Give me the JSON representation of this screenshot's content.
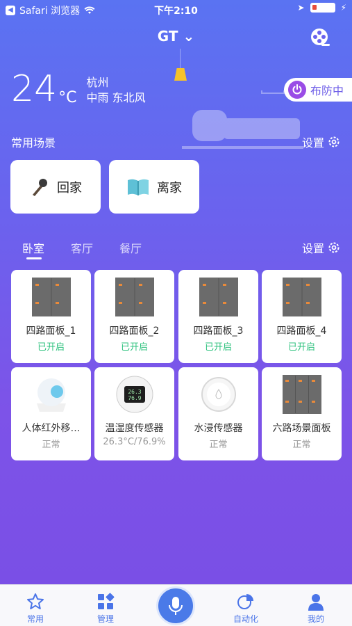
{
  "status_bar": {
    "carrier": "Safari 浏览器",
    "time": "下午2:10"
  },
  "header": {
    "title": "GT ⌄"
  },
  "weather": {
    "temp": "24",
    "unit": "°C",
    "city": "杭州",
    "condition": "中雨 东北风"
  },
  "arm_button": {
    "label": "布防中"
  },
  "scenes": {
    "title": "常用场景",
    "settings_label": "设置",
    "items": [
      {
        "label": "回家",
        "icon": "microphone-icon"
      },
      {
        "label": "离家",
        "icon": "open-book-icon"
      }
    ]
  },
  "rooms": {
    "tabs": [
      "卧室",
      "客厅",
      "餐厅"
    ],
    "active_tab": "卧室",
    "settings_label": "设置"
  },
  "devices": [
    {
      "name": "四路面板_1",
      "status": "已开启",
      "status_color": "#2ec27e",
      "icon": "panel-icon"
    },
    {
      "name": "四路面板_2",
      "status": "已开启",
      "status_color": "#2ec27e",
      "icon": "panel-icon"
    },
    {
      "name": "四路面板_3",
      "status": "已开启",
      "status_color": "#2ec27e",
      "icon": "panel-icon"
    },
    {
      "name": "四路面板_4",
      "status": "已开启",
      "status_color": "#2ec27e",
      "icon": "panel-icon"
    },
    {
      "name": "人体红外移…",
      "status": "正常",
      "status_color": "#999999",
      "icon": "motion-sensor-icon"
    },
    {
      "name": "温湿度传感器",
      "status": "26.3°C/76.9%",
      "status_color": "#999999",
      "icon": "thermometer-display-icon"
    },
    {
      "name": "水浸传感器",
      "status": "正常",
      "status_color": "#999999",
      "icon": "water-sensor-icon"
    },
    {
      "name": "六路场景面板",
      "status": "正常",
      "status_color": "#999999",
      "icon": "six-panel-icon"
    }
  ],
  "tabbar": {
    "items": [
      {
        "label": "常用",
        "icon": "star-icon"
      },
      {
        "label": "管理",
        "icon": "grid-icon"
      },
      {
        "label": "",
        "icon": "microphone-icon"
      },
      {
        "label": "自动化",
        "icon": "pie-chart-icon"
      },
      {
        "label": "我的",
        "icon": "person-icon"
      }
    ]
  },
  "colors": {
    "accent": "#4a74e8",
    "bg_top": "#5a73f2",
    "bg_bottom": "#7a4fe6",
    "arm": "#9a4ce6",
    "on": "#2ec27e"
  }
}
